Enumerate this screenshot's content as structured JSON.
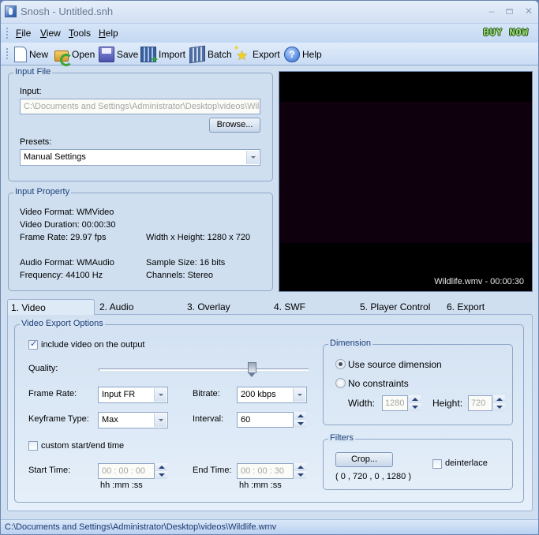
{
  "window": {
    "title": "Snosh - Untitled.snh",
    "buy_now": "BUY NOW",
    "min_glyph": "–",
    "close_glyph": "✕"
  },
  "menu": {
    "items": [
      {
        "label": "File",
        "accel": "F",
        "rest": "ile"
      },
      {
        "label": "View",
        "accel": "V",
        "rest": "iew"
      },
      {
        "label": "Tools",
        "accel": "T",
        "rest": "ools"
      },
      {
        "label": "Help",
        "accel": "H",
        "rest": "elp"
      }
    ]
  },
  "toolbar": {
    "buttons": [
      {
        "label": "New",
        "icon": "new-document-icon"
      },
      {
        "label": "Open",
        "icon": "open-folder-icon"
      },
      {
        "label": "Save",
        "icon": "save-disk-icon"
      },
      {
        "label": "Import",
        "icon": "import-film-icon"
      },
      {
        "label": "Batch",
        "icon": "batch-films-icon"
      },
      {
        "label": "Export",
        "icon": "export-stars-icon"
      },
      {
        "label": "Help",
        "icon": "help-question-icon",
        "glyph": "?"
      }
    ]
  },
  "input_file": {
    "group_title": "Input File",
    "input_label": "Input:",
    "input_value": "C:\\Documents and Settings\\Administrator\\Desktop\\videos\\Wildlife.wmv",
    "browse_label": "Browse...",
    "presets_label": "Presets:",
    "presets_value": "Manual Settings"
  },
  "input_property": {
    "group_title": "Input Property",
    "video_format": "Video Format: WMVideo",
    "video_duration": "Video Duration: 00:00:30",
    "frame_rate": "Frame Rate: 29.97 fps",
    "dimensions": "Width x Height: 1280 x 720",
    "audio_format": "Audio Format: WMAudio",
    "sample_size": "Sample Size: 16 bits",
    "frequency": "Frequency: 44100 Hz",
    "channels": "Channels: Stereo"
  },
  "preview": {
    "caption": "Wildlife.wmv - 00:00:30"
  },
  "tabs": [
    {
      "label": "1. Video",
      "active": true
    },
    {
      "label": "2. Audio",
      "active": false
    },
    {
      "label": "3. Overlay",
      "active": false
    },
    {
      "label": "4. SWF",
      "active": false
    },
    {
      "label": "5. Player Control",
      "active": false
    },
    {
      "label": "6. Export",
      "active": false
    }
  ],
  "video_options": {
    "group_title": "Video Export Options",
    "include_video_label": "include video on the output",
    "include_video_checked": true,
    "quality_label": "Quality:",
    "quality_fraction": 0.74,
    "frame_rate_label": "Frame Rate:",
    "frame_rate_value": "Input FR",
    "bitrate_label": "Bitrate:",
    "bitrate_value": "200 kbps",
    "keyframe_label": "Keyframe Type:",
    "keyframe_value": "Max",
    "interval_label": "Interval:",
    "interval_value": "60",
    "custom_time_label": "custom start/end time",
    "custom_time_checked": false,
    "start_time_label": "Start Time:",
    "start_time_value": "00 : 00 : 00",
    "end_time_label": "End Time:",
    "end_time_value": "00 : 00 : 30",
    "time_format": "hh :mm :ss"
  },
  "dimension": {
    "group_title": "Dimension",
    "use_source_label": "Use source dimension",
    "no_constraints_label": "No constraints",
    "selected": "use_source",
    "width_label": "Width:",
    "width_value": "1280",
    "height_label": "Height:",
    "height_value": "720"
  },
  "filters": {
    "group_title": "Filters",
    "crop_label": "Crop...",
    "crop_values": "( 0 , 720 , 0 , 1280 )",
    "deinterlace_label": "deinterlace",
    "deinterlace_checked": false
  },
  "statusbar": {
    "text": "C:\\Documents and Settings\\Administrator\\Desktop\\videos\\Wildlife.wmv"
  }
}
